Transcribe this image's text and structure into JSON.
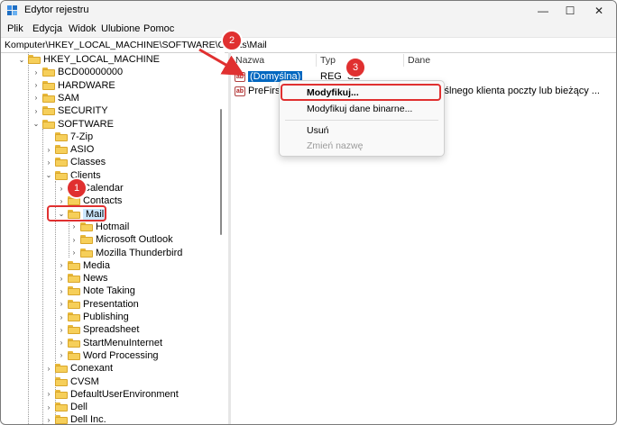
{
  "window": {
    "title": "Edytor rejestru",
    "minimize_glyph": "—",
    "maximize_glyph": "☐",
    "close_glyph": "✕"
  },
  "menu": [
    "Plik",
    "Edycja",
    "Widok",
    "Ulubione",
    "Pomoc"
  ],
  "address": "Komputer\\HKEY_LOCAL_MACHINE\\SOFTWARE\\Clients\\Mail",
  "tree": {
    "chevron_open": "⌄",
    "chevron_closed": "›",
    "items": [
      {
        "label": "HKEY_LOCAL_MACHINE"
      },
      {
        "label": "BCD00000000"
      },
      {
        "label": "HARDWARE"
      },
      {
        "label": "SAM"
      },
      {
        "label": "SECURITY"
      },
      {
        "label": "SOFTWARE"
      },
      {
        "label": "7-Zip"
      },
      {
        "label": "ASIO"
      },
      {
        "label": "Classes"
      },
      {
        "label": "Clients"
      },
      {
        "label": "Calendar"
      },
      {
        "label": "Contacts"
      },
      {
        "label": "Mail"
      },
      {
        "label": "Hotmail"
      },
      {
        "label": "Microsoft Outlook"
      },
      {
        "label": "Mozilla Thunderbird"
      },
      {
        "label": "Media"
      },
      {
        "label": "News"
      },
      {
        "label": "Note Taking"
      },
      {
        "label": "Presentation"
      },
      {
        "label": "Publishing"
      },
      {
        "label": "Spreadsheet"
      },
      {
        "label": "StartMenuInternet"
      },
      {
        "label": "Word Processing"
      },
      {
        "label": "Conexant"
      },
      {
        "label": "CVSM"
      },
      {
        "label": "DefaultUserEnvironment"
      },
      {
        "label": "Dell"
      },
      {
        "label": "Dell Inc."
      }
    ]
  },
  "list": {
    "headers": {
      "name": "Nazwa",
      "type": "Typ",
      "data": "Dane"
    },
    "rows": [
      {
        "name": "(Domyślna)",
        "type": "REG_SZ",
        "data": ""
      },
      {
        "name": "PreFirstR",
        "type": "",
        "data": "yślnego klienta poczty lub bieżący ..."
      }
    ],
    "icon_text": "ab"
  },
  "context_menu": {
    "items": [
      "Modyfikuj...",
      "Modyfikuj dane binarne...",
      "Usuń",
      "Zmień nazwę"
    ]
  },
  "annotations": [
    "1",
    "2",
    "3"
  ],
  "colors": {
    "accent": "#0067c0",
    "annotation": "#e03030",
    "selection": "#cce8ff"
  }
}
